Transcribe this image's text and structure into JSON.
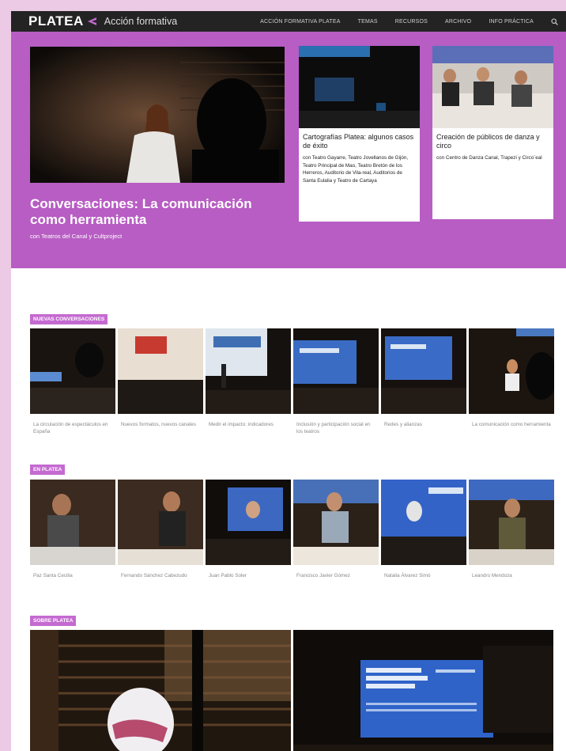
{
  "nav": {
    "logo": "PLATEA",
    "subtitle": "Acción formativa",
    "items": [
      "ACCIÓN FORMATIVA PLATEA",
      "TEMAS",
      "RECURSOS",
      "ARCHIVO",
      "INFO PRÁCTICA"
    ],
    "search_icon": "search-icon"
  },
  "hero": {
    "title": "Conversaciones: La comunicación como herramienta",
    "byline": "con Teatros del Canal y Cultproject",
    "cards": [
      {
        "title": "Cartografías Platea: algunos casos de éxito",
        "text": "con Teatro Gayarre, Teatro Jovellanos de Gijón, Teatro Principal de Mao, Teatro Bretón de los Herreros, Auditorio de Vila-real, Auditorios de Santa Eulalia y Teatro de Cartaya"
      },
      {
        "title": "Creación de públicos de danza y circo",
        "text": "con Centro de Danza Canal, Trapezi y Circo´eal"
      }
    ]
  },
  "sections": {
    "nuevas": {
      "label": "NUEVAS CONVERSACIONES",
      "items": [
        "La circulación de espectáculos en España",
        "Nuevos formatos, nuevos canales",
        "Medir el impacto: indicadores",
        "Inclusión y participación social en los teatros",
        "Redes y alianzas",
        "La comunicación como herramienta"
      ]
    },
    "enplatea": {
      "label": "EN PLATEA",
      "items": [
        "Paz Santa Cecilia",
        "Fernando Sánchez Cabezudo",
        "Juan Pablo Soler",
        "Francisco Javier Gómez",
        "Natalia Álvarez Simó",
        "Leandro Mendoza"
      ]
    },
    "sobre": {
      "label": "SOBRE PLATEA"
    }
  },
  "colors": {
    "accent": "#b75dc3",
    "badge": "#c46ad0",
    "nav_bg": "#232323",
    "page_bg": "#ecc9e4"
  }
}
